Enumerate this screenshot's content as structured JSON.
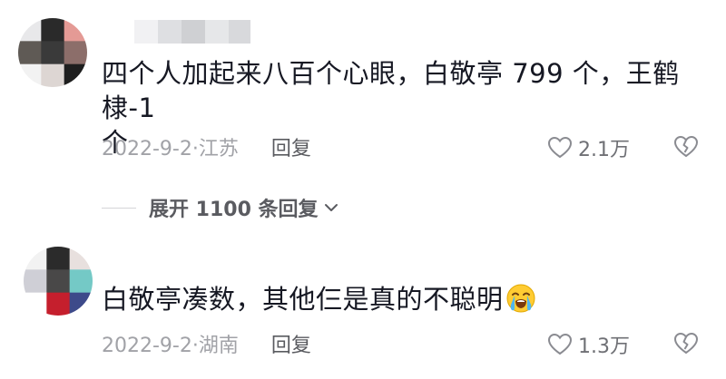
{
  "comments": [
    {
      "text_line1": "四个人加起来八百个心眼，白敬亭 799 个，王鹤棣-1",
      "text_line2": "个",
      "date_location": "2022-9-2·江苏",
      "reply_label": "回复",
      "like_count": "2.1万",
      "avatar_colors": [
        "#e8e8ea",
        "#2a2a2a",
        "#e49a95",
        "#5f5a55",
        "#3a3a3a",
        "#8c6e6a",
        "#f2f2f2",
        "#ddd6d3",
        "#1e1e1e"
      ]
    },
    {
      "text": "白敬亭凑数，其他仨是真的不聪明",
      "emoji_icon": "loudly-crying-face-icon",
      "date_location": "2022-9-2·湖南",
      "reply_label": "回复",
      "like_count": "1.3万",
      "avatar_colors": [
        "#f2f2f2",
        "#2b2b2b",
        "#e8e0de",
        "#cfcfd6",
        "#494848",
        "#74c9c6",
        "#ffffff",
        "#c51f2d",
        "#3d4a8a"
      ]
    }
  ],
  "expand_replies_label": "展开 1100 条回复",
  "icons": {
    "like": "heart-outline-icon",
    "dislike": "broken-heart-icon",
    "expand": "chevron-down-icon"
  }
}
